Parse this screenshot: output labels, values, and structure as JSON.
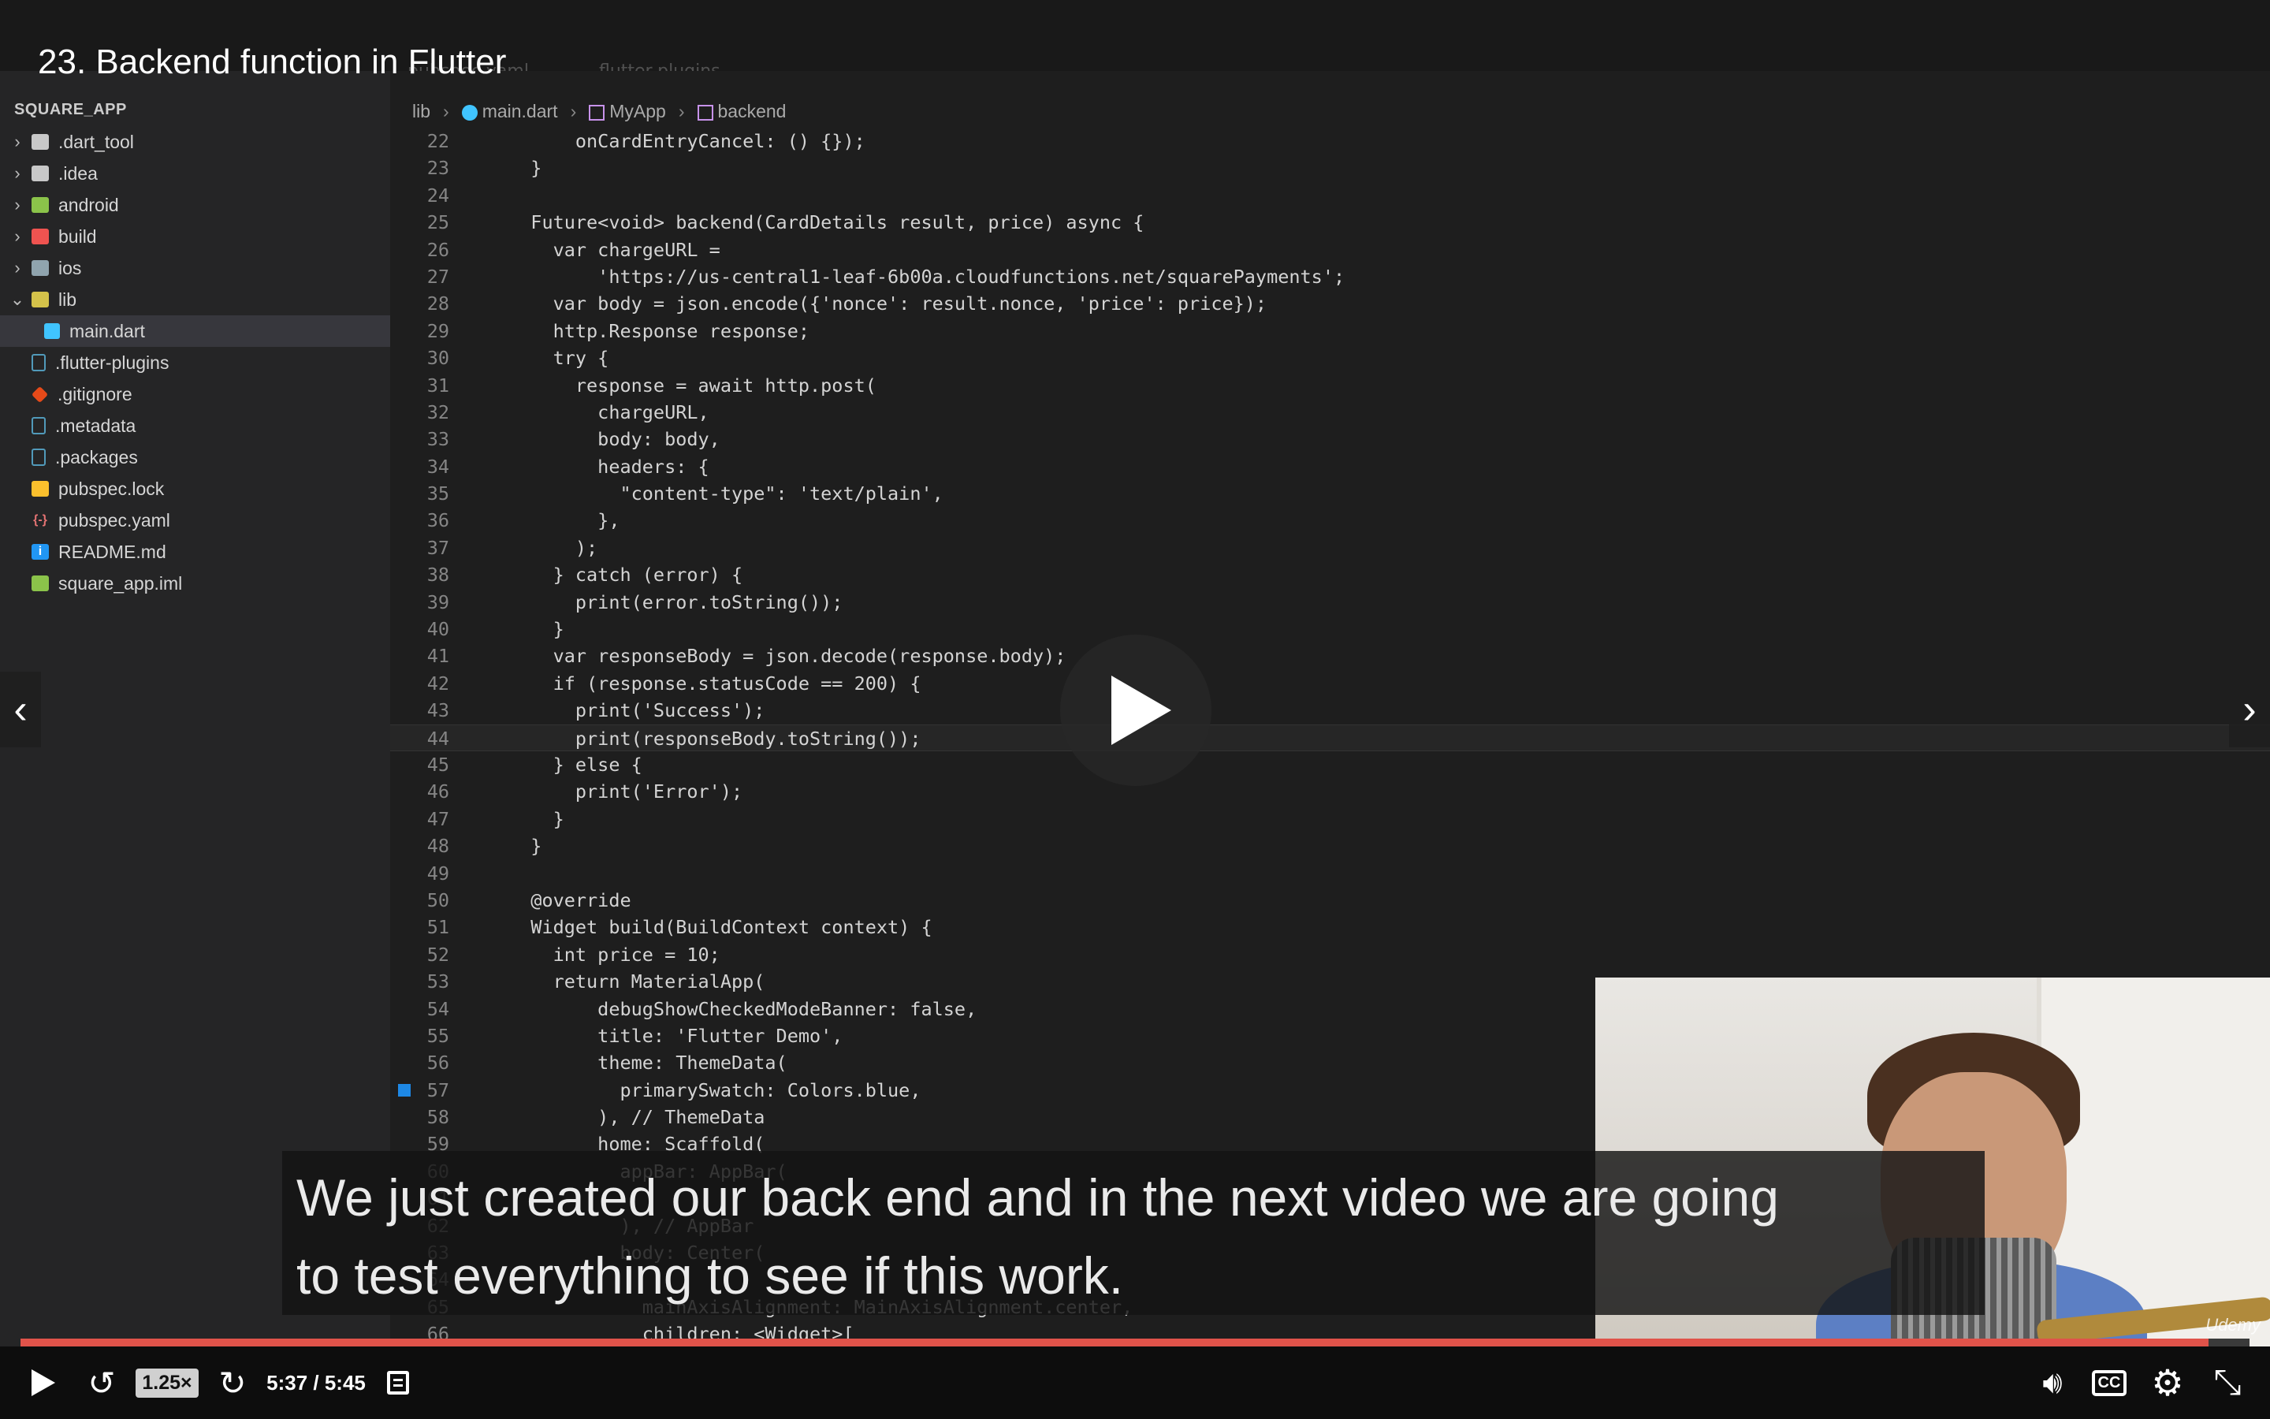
{
  "video": {
    "title": "23. Backend function in Flutter",
    "caption_line1": "We just created our back end and in the next video we are going",
    "caption_line2": "to test everything to see if this work.",
    "progress_fraction": 0.9817,
    "accent_color": "#e0534a"
  },
  "ide": {
    "tabs": [
      "pubspec.yaml",
      ".flutter-plugins"
    ],
    "explorer_title": "SQUARE_APP",
    "tree": [
      {
        "label": ".dart_tool",
        "kind": "folder",
        "icon": "folder-icon",
        "chevron": "›"
      },
      {
        "label": ".idea",
        "kind": "folder",
        "icon": "folder-icon",
        "chevron": "›"
      },
      {
        "label": "android",
        "kind": "folder-green",
        "icon": "android-folder-icon",
        "chevron": "›"
      },
      {
        "label": "build",
        "kind": "folder-red",
        "icon": "build-folder-icon",
        "chevron": "›"
      },
      {
        "label": "ios",
        "kind": "folder-blue",
        "icon": "ios-folder-icon",
        "chevron": "›"
      },
      {
        "label": "lib",
        "kind": "folder-lib",
        "icon": "lib-folder-icon",
        "chevron": "⌄"
      },
      {
        "label": "main.dart",
        "kind": "file-dart",
        "icon": "dart-file-icon",
        "indent": true,
        "active": true
      },
      {
        "label": ".flutter-plugins",
        "kind": "file-doc",
        "icon": "file-icon"
      },
      {
        "label": ".gitignore",
        "kind": "file-git",
        "icon": "git-icon"
      },
      {
        "label": ".metadata",
        "kind": "file-doc",
        "icon": "file-icon"
      },
      {
        "label": ".packages",
        "kind": "file-doc",
        "icon": "file-icon"
      },
      {
        "label": "pubspec.lock",
        "kind": "file-lock",
        "icon": "lock-icon"
      },
      {
        "label": "pubspec.yaml",
        "kind": "file-yaml",
        "icon": "yaml-icon",
        "glyph": "{-}"
      },
      {
        "label": "README.md",
        "kind": "file-info",
        "icon": "info-icon",
        "glyph": "i"
      },
      {
        "label": "square_app.iml",
        "kind": "file-iml",
        "icon": "iml-file-icon"
      }
    ],
    "breadcrumbs": {
      "root": "lib",
      "file": "main.dart",
      "class": "MyApp",
      "method": "backend"
    },
    "code_lines": [
      {
        "n": "22",
        "t": "      onCardEntryCancel: () {});"
      },
      {
        "n": "23",
        "t": "  }"
      },
      {
        "n": "24",
        "t": ""
      },
      {
        "n": "25",
        "t": "  Future<void> backend(CardDetails result, price) async {"
      },
      {
        "n": "26",
        "t": "    var chargeURL ="
      },
      {
        "n": "27",
        "t": "        'https://us-central1-leaf-6b00a.cloudfunctions.net/squarePayments';"
      },
      {
        "n": "28",
        "t": "    var body = json.encode({'nonce': result.nonce, 'price': price});"
      },
      {
        "n": "29",
        "t": "    http.Response response;"
      },
      {
        "n": "30",
        "t": "    try {"
      },
      {
        "n": "31",
        "t": "      response = await http.post("
      },
      {
        "n": "32",
        "t": "        chargeURL,"
      },
      {
        "n": "33",
        "t": "        body: body,"
      },
      {
        "n": "34",
        "t": "        headers: {"
      },
      {
        "n": "35",
        "t": "          \"content-type\": 'text/plain',"
      },
      {
        "n": "36",
        "t": "        },"
      },
      {
        "n": "37",
        "t": "      );"
      },
      {
        "n": "38",
        "t": "    } catch (error) {"
      },
      {
        "n": "39",
        "t": "      print(error.toString());"
      },
      {
        "n": "40",
        "t": "    }"
      },
      {
        "n": "41",
        "t": "    var responseBody = json.decode(response.body);"
      },
      {
        "n": "42",
        "t": "    if (response.statusCode == 200) {"
      },
      {
        "n": "43",
        "t": "      print('Success');"
      },
      {
        "n": "44",
        "t": "      print(responseBody.toString());",
        "highlight": true
      },
      {
        "n": "45",
        "t": "    } else {"
      },
      {
        "n": "46",
        "t": "      print('Error');"
      },
      {
        "n": "47",
        "t": "    }"
      },
      {
        "n": "48",
        "t": "  }"
      },
      {
        "n": "49",
        "t": ""
      },
      {
        "n": "50",
        "t": "  @override"
      },
      {
        "n": "51",
        "t": "  Widget build(BuildContext context) {"
      },
      {
        "n": "52",
        "t": "    int price = 10;"
      },
      {
        "n": "53",
        "t": "    return MaterialApp("
      },
      {
        "n": "54",
        "t": "        debugShowCheckedModeBanner: false,"
      },
      {
        "n": "55",
        "t": "        title: 'Flutter Demo',"
      },
      {
        "n": "56",
        "t": "        theme: ThemeData("
      },
      {
        "n": "57",
        "t": "          primarySwatch: Colors.blue,",
        "marker": true
      },
      {
        "n": "58",
        "t": "        ), // ThemeData"
      },
      {
        "n": "59",
        "t": "        home: Scaffold("
      },
      {
        "n": "60",
        "t": "          appBar: AppBar("
      },
      {
        "n": "61",
        "t": ""
      },
      {
        "n": "62",
        "t": "          ), // AppBar"
      },
      {
        "n": "63",
        "t": "          body: Center("
      },
      {
        "n": "64",
        "t": ""
      },
      {
        "n": "65",
        "t": "            mainAxisAlignment: MainAxisAlignment.center,"
      },
      {
        "n": "66",
        "t": "            children: <Widget>["
      }
    ]
  },
  "webcam": {
    "watermark": "Udemy"
  },
  "controls": {
    "speed": "1.25×",
    "time": "5:37 / 5:45",
    "icons": {
      "play": "play-icon",
      "rewind": "rewind-icon",
      "forward": "forward-icon",
      "notes": "notes-icon",
      "volume": "volume-icon",
      "captions": "closed-captions-icon",
      "settings": "gear-icon",
      "exit_fullscreen": "exit-fullscreen-icon"
    },
    "cc_label": "CC"
  }
}
